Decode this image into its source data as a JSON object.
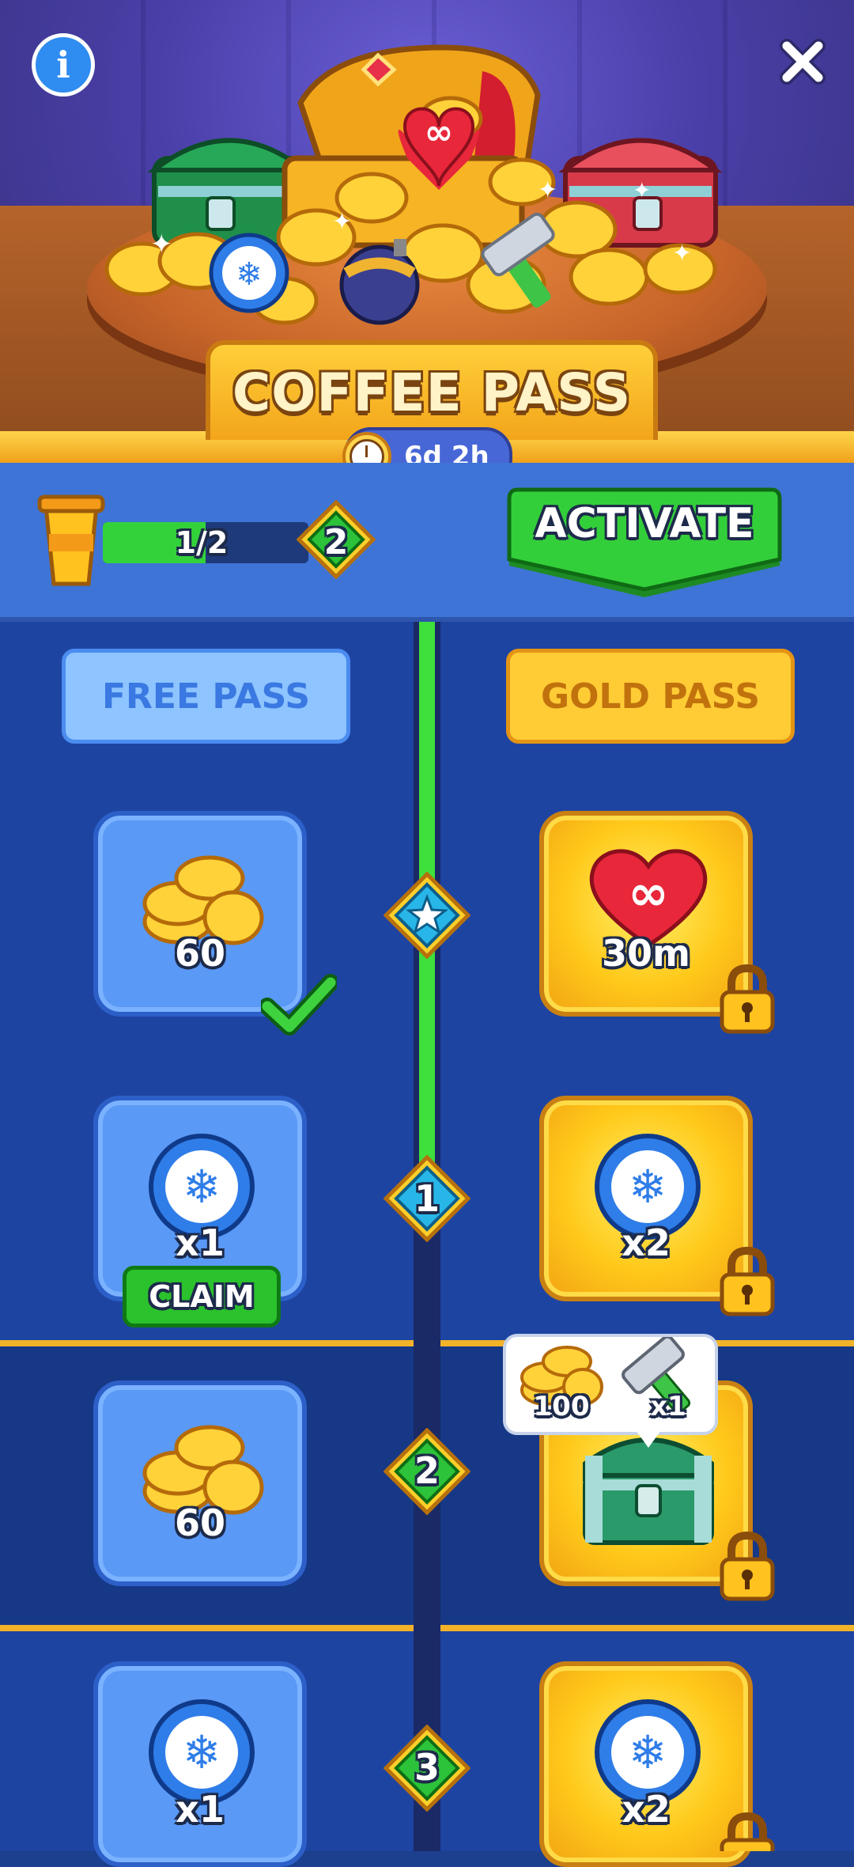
{
  "header": {
    "title": "COFFEE PASS",
    "timer": "6d 2h",
    "info_icon": "info-icon",
    "close_icon": "close-icon"
  },
  "progress": {
    "label": "1/2",
    "fraction": 0.5,
    "level": "2",
    "activate_label": "ACTIVATE"
  },
  "tabs": {
    "free": "FREE PASS",
    "gold": "GOLD PASS"
  },
  "rows": [
    {
      "node": "star",
      "free": {
        "icon": "coins-icon",
        "label": "60",
        "claimed": true
      },
      "gold": {
        "icon": "infinite-heart-icon",
        "label": "30m",
        "locked": true
      }
    },
    {
      "node": "1",
      "free": {
        "icon": "snowflake-booster-icon",
        "label": "x1",
        "claim_label": "CLAIM"
      },
      "gold": {
        "icon": "snowflake-booster-icon",
        "label": "x2",
        "locked": true
      }
    },
    {
      "node": "2",
      "free": {
        "icon": "coins-icon",
        "label": "60"
      },
      "gold": {
        "icon": "chest-icon",
        "locked": true,
        "tooltip": {
          "coins": "100",
          "hammer": "x1"
        }
      }
    },
    {
      "node": "3",
      "free": {
        "icon": "snowflake-booster-icon",
        "label": "x1"
      },
      "gold": {
        "icon": "snowflake-booster-icon",
        "label": "x2",
        "locked": true
      }
    }
  ],
  "colors": {
    "track_fill": "#3ee03b",
    "claim_green": "#2bc22d",
    "gold": "#ffc91a",
    "free_blue": "#5a99f5"
  }
}
